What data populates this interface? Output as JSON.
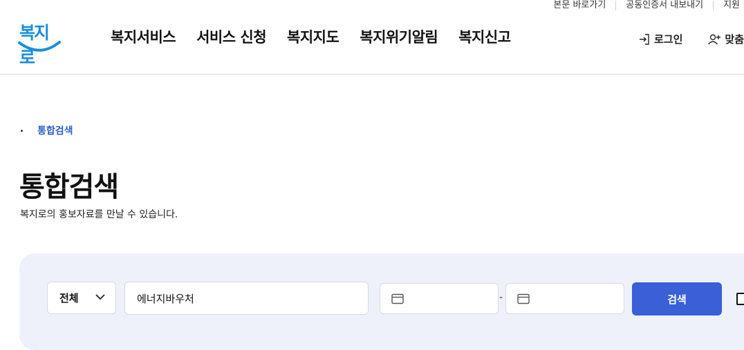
{
  "utility_nav": {
    "items": [
      "본문 바로가기",
      "공동인증서 내보내기",
      "지원"
    ]
  },
  "header": {
    "logo_text": "복지로",
    "nav": [
      "복지서비스",
      "서비스 신청",
      "복지지도",
      "복지위기알림",
      "복지신고"
    ],
    "login_label": "로그인",
    "custom_label": "맞춤"
  },
  "breadcrumb": {
    "current": "통합검색"
  },
  "page": {
    "title": "통합검색",
    "description": "복지로의 홍보자료를 만날 수 있습니다."
  },
  "search": {
    "category_selected": "전체",
    "query_value": "에너지바우처",
    "date_separator": "-",
    "button_label": "검색"
  },
  "colors": {
    "brand_blue": "#1a8fdd",
    "accent": "#3a5fd6",
    "panel_bg": "#eef1fa",
    "breadcrumb_link": "#2f5fc9"
  },
  "icons": [
    "login-icon",
    "user-plus-icon",
    "chevron-down-icon",
    "calendar-icon",
    "smile-logo-icon"
  ]
}
